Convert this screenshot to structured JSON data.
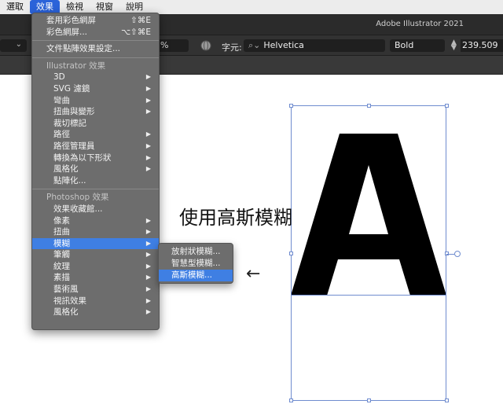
{
  "menubar": {
    "items": [
      "選取",
      "效果",
      "檢視",
      "視窗",
      "說明"
    ]
  },
  "app": {
    "title": "Adobe Illustrator 2021"
  },
  "controlbar": {
    "percent_suffix": "%",
    "char_label": "字元:",
    "font_name": "Helvetica",
    "font_style": "Bold",
    "font_size": "239.509"
  },
  "canvas": {
    "glyph": "A",
    "annotation": "使用高斯模糊",
    "arrow": "←"
  },
  "effect_menu": {
    "apply_last": {
      "label": "套用彩色網屏",
      "shortcut": "⇧⌘E"
    },
    "last_effect": {
      "label": "彩色網屏...",
      "shortcut": "⌥⇧⌘E"
    },
    "document_raster": "文件點陣效果設定...",
    "illustrator_header": "Illustrator 效果",
    "illustrator_items": [
      "3D",
      "SVG 濾鏡",
      "彎曲",
      "扭曲與變形",
      "裁切標記",
      "路徑",
      "路徑管理員",
      "轉換為以下形狀",
      "風格化",
      "點陣化..."
    ],
    "photoshop_header": "Photoshop 效果",
    "photoshop_items": [
      "效果收藏館...",
      "像素",
      "扭曲",
      "模糊",
      "筆觸",
      "紋理",
      "素描",
      "藝術風",
      "視訊效果",
      "風格化"
    ]
  },
  "blur_submenu": {
    "items": [
      "放射狀模糊...",
      "智慧型模糊...",
      "高斯模糊..."
    ]
  }
}
